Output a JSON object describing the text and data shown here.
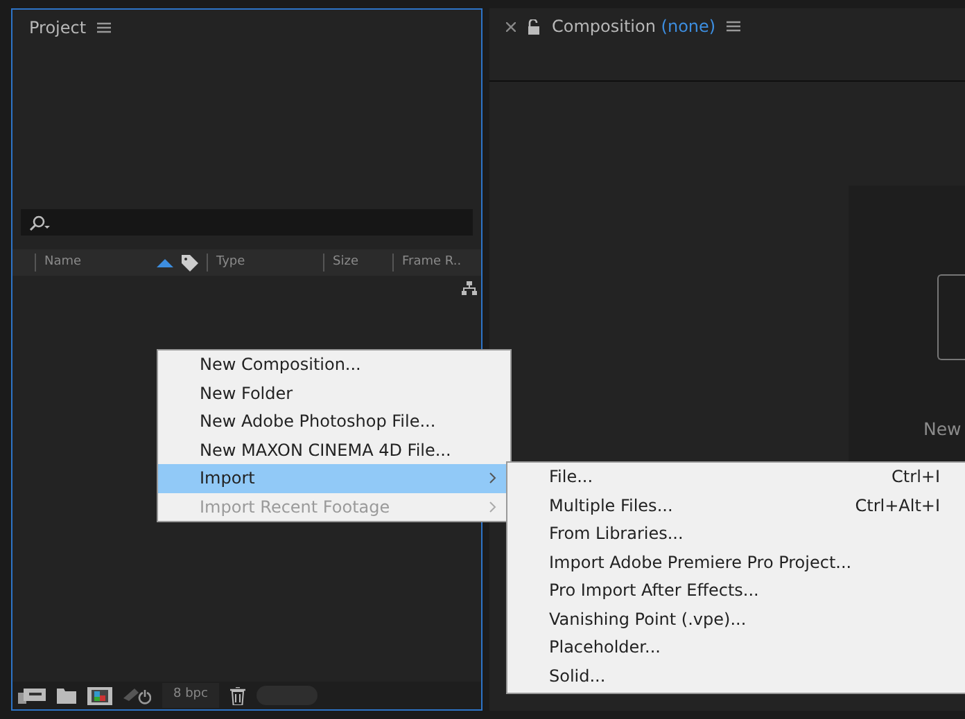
{
  "project_panel": {
    "title": "Project",
    "columns": [
      {
        "label": "Name",
        "sorted": true
      },
      {
        "label": "Type",
        "sorted": false
      },
      {
        "label": "Size",
        "sorted": false
      },
      {
        "label": "Frame R..",
        "sorted": false
      }
    ],
    "bit_depth": "8 bpc"
  },
  "composition_panel": {
    "title": "Composition",
    "subtitle": "(none)",
    "viewer_text": "New"
  },
  "context_menu": [
    {
      "label": "New Composition...",
      "selected": false,
      "disabled": false,
      "submenu": false
    },
    {
      "label": "New Folder",
      "selected": false,
      "disabled": false,
      "submenu": false
    },
    {
      "label": "New Adobe Photoshop File...",
      "selected": false,
      "disabled": false,
      "submenu": false
    },
    {
      "label": "New MAXON CINEMA 4D File...",
      "selected": false,
      "disabled": false,
      "submenu": false
    },
    {
      "label": "Import",
      "selected": true,
      "disabled": false,
      "submenu": true
    },
    {
      "label": "Import Recent Footage",
      "selected": false,
      "disabled": true,
      "submenu": true
    }
  ],
  "submenu": [
    {
      "label": "File...",
      "shortcut": "Ctrl+I"
    },
    {
      "label": "Multiple Files...",
      "shortcut": "Ctrl+Alt+I"
    },
    {
      "label": "From Libraries..."
    },
    {
      "label": "Import Adobe Premiere Pro Project..."
    },
    {
      "label": "Pro Import After Effects..."
    },
    {
      "label": "Vanishing Point (.vpe)..."
    },
    {
      "label": "Placeholder..."
    },
    {
      "label": "Solid..."
    }
  ]
}
